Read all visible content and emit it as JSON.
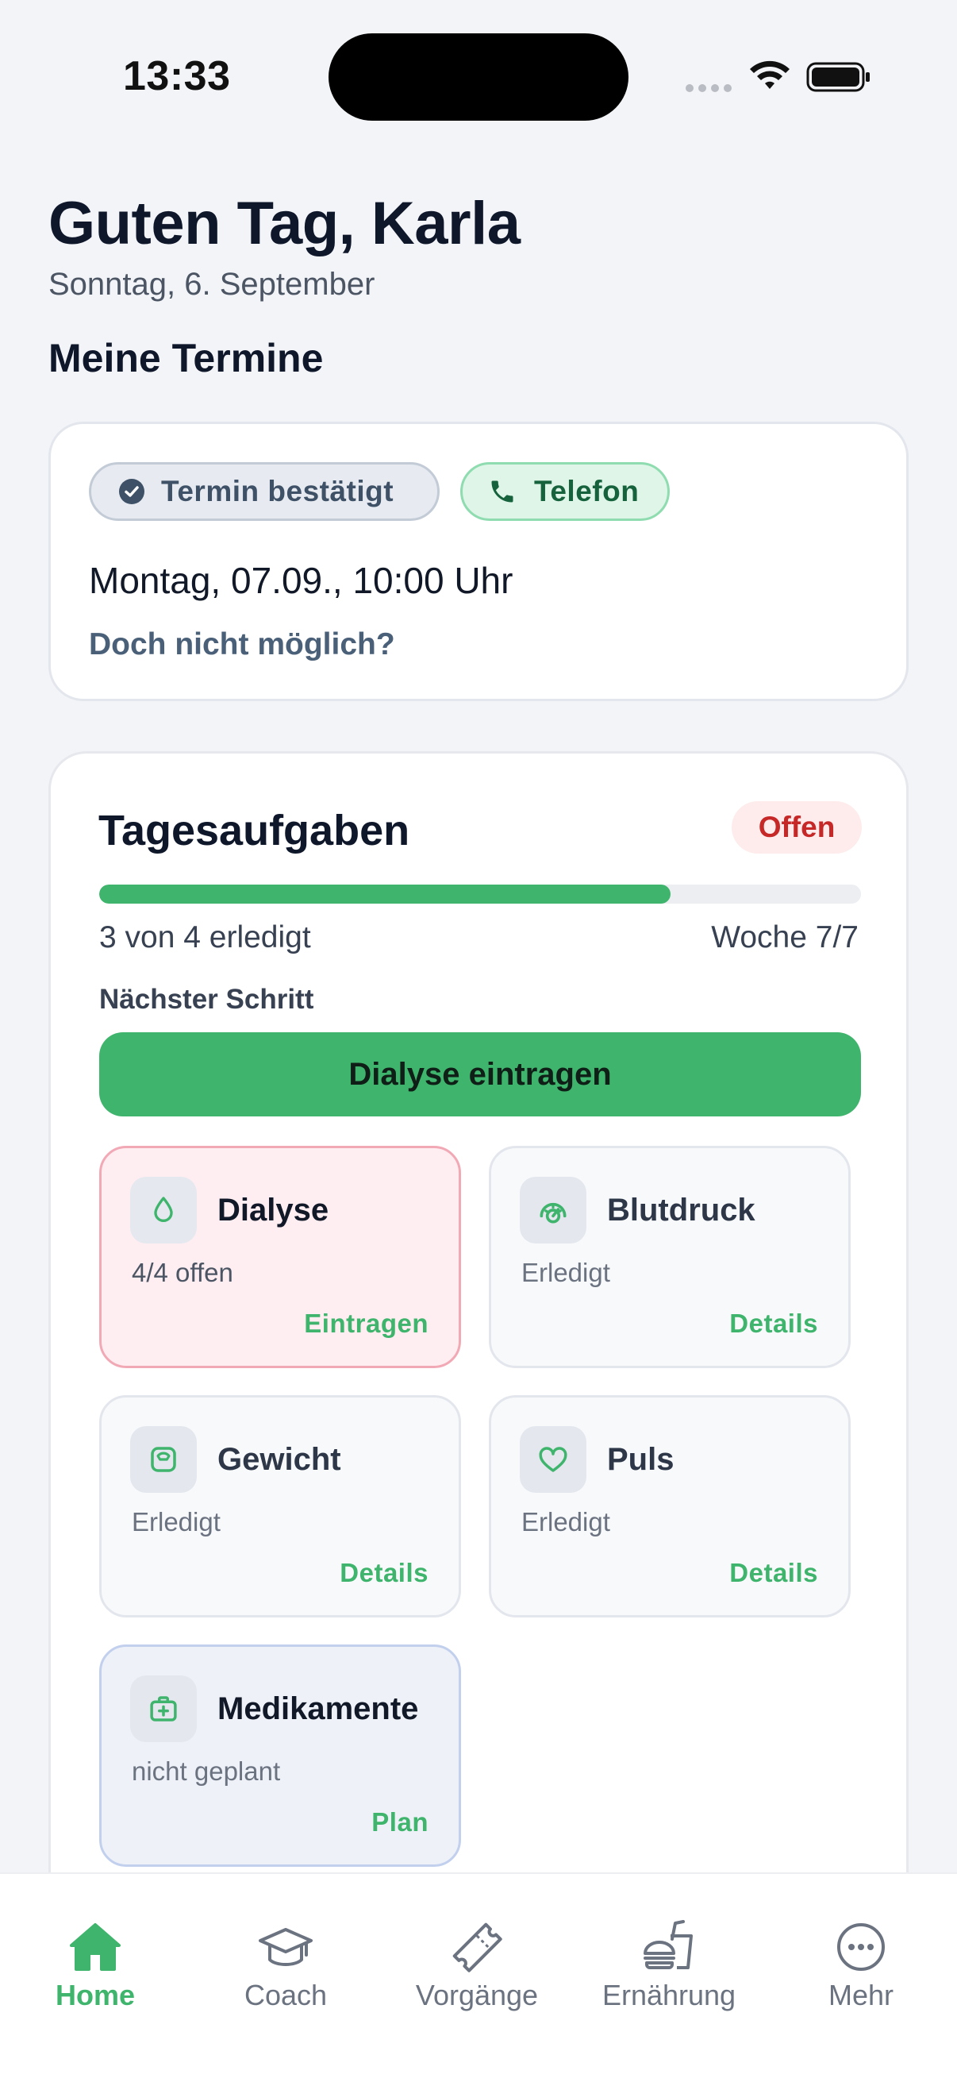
{
  "status_bar": {
    "time": "13:33"
  },
  "header": {
    "greeting": "Guten Tag, Karla",
    "date": "Sonntag, 6. September",
    "section_title": "Meine Termine"
  },
  "appointment": {
    "status_chip": "Termin bestätigt",
    "type_chip": "Telefon",
    "datetime": "Montag, 07.09., 10:00 Uhr",
    "reschedule_link": "Doch nicht möglich?"
  },
  "tasks": {
    "title": "Tagesaufgaben",
    "status_badge": "Offen",
    "progress_completed": 3,
    "progress_total": 4,
    "progress_text": "3 von 4 erledigt",
    "week_text": "Woche 7/7",
    "next_step_label": "Nächster Schritt",
    "primary_action": "Dialyse eintragen",
    "items": [
      {
        "title": "Dialyse",
        "status": "4/4 offen",
        "action": "Eintragen",
        "icon": "droplet-icon"
      },
      {
        "title": "Blutdruck",
        "status": "Erledigt",
        "action": "Details",
        "icon": "gauge-icon"
      },
      {
        "title": "Gewicht",
        "status": "Erledigt",
        "action": "Details",
        "icon": "scale-icon"
      },
      {
        "title": "Puls",
        "status": "Erledigt",
        "action": "Details",
        "icon": "heart-icon"
      },
      {
        "title": "Medikamente",
        "status": "nicht geplant",
        "action": "Plan",
        "icon": "medkit-icon"
      }
    ]
  },
  "tab_bar": {
    "tabs": [
      {
        "label": "Home",
        "icon": "home-icon",
        "active": true
      },
      {
        "label": "Coach",
        "icon": "graduation-cap-icon",
        "active": false
      },
      {
        "label": "Vorgänge",
        "icon": "ticket-icon",
        "active": false
      },
      {
        "label": "Ernährung",
        "icon": "food-icon",
        "active": false
      },
      {
        "label": "Mehr",
        "icon": "more-icon",
        "active": false
      }
    ]
  },
  "colors": {
    "accent_green": "#3fb46c",
    "open_red": "#c62828",
    "background": "#f3f4f8"
  }
}
